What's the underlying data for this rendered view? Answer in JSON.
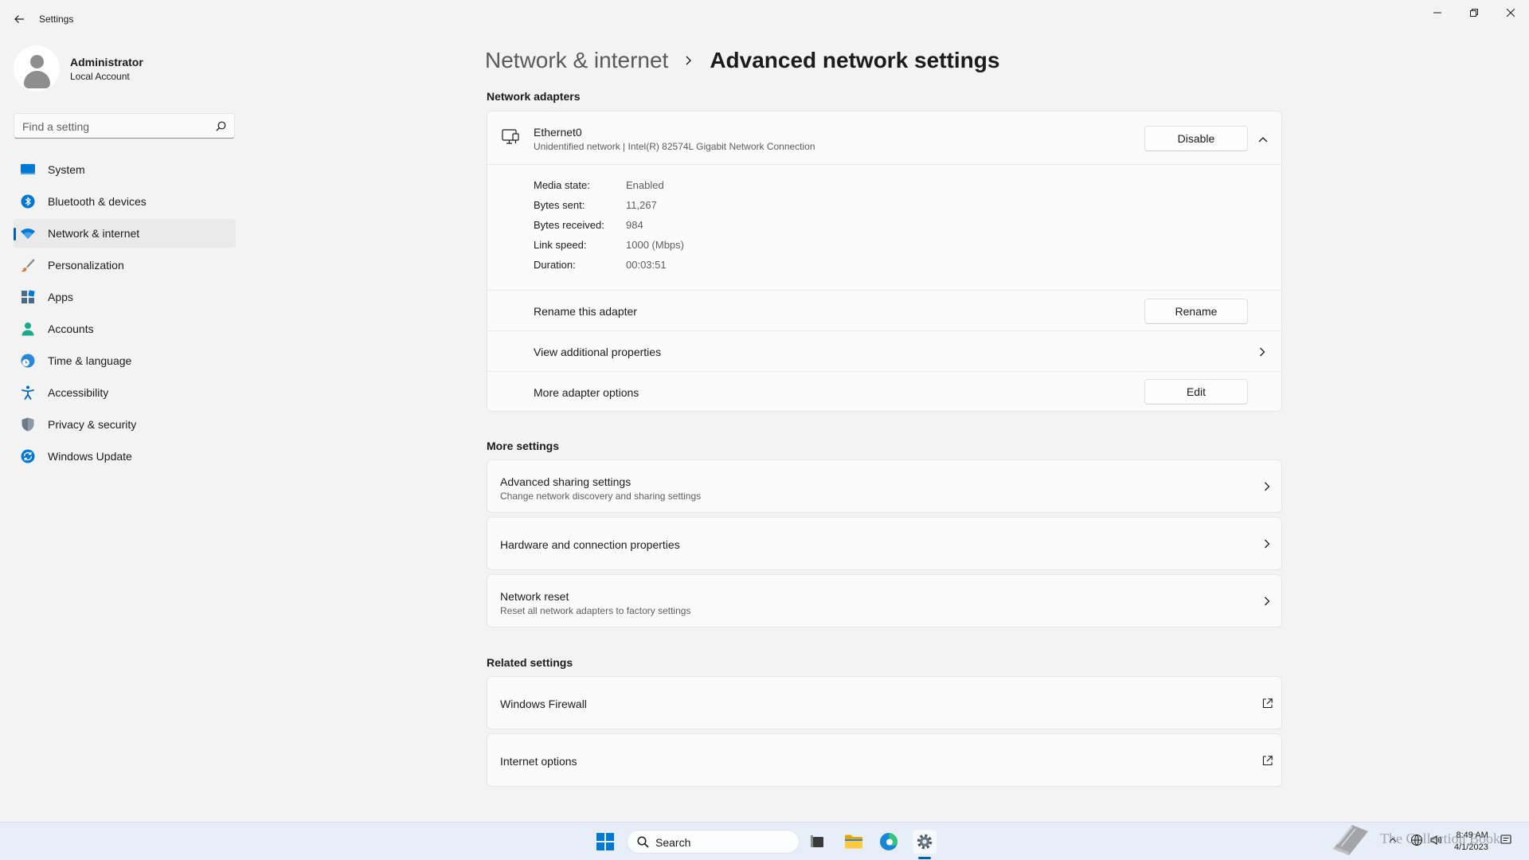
{
  "window": {
    "title": "Settings"
  },
  "profile": {
    "name": "Administrator",
    "account_type": "Local Account"
  },
  "search": {
    "placeholder": "Find a setting"
  },
  "sidebar": {
    "items": [
      {
        "label": "System",
        "icon": "system-icon",
        "color": "#0078d4",
        "active": false
      },
      {
        "label": "Bluetooth & devices",
        "icon": "bluetooth-icon",
        "color": "#0078d4",
        "active": false
      },
      {
        "label": "Network & internet",
        "icon": "wifi-icon",
        "color": "#0078d4",
        "active": true
      },
      {
        "label": "Personalization",
        "icon": "brush-icon",
        "color": "#d67d2f",
        "active": false
      },
      {
        "label": "Apps",
        "icon": "apps-icon",
        "color": "#4a6b8c",
        "active": false
      },
      {
        "label": "Accounts",
        "icon": "person-icon",
        "color": "#1aab8a",
        "active": false
      },
      {
        "label": "Time & language",
        "icon": "globe-clock-icon",
        "color": "#2b88d8",
        "active": false
      },
      {
        "label": "Accessibility",
        "icon": "accessibility-icon",
        "color": "#0067c0",
        "active": false
      },
      {
        "label": "Privacy & security",
        "icon": "shield-icon",
        "color": "#6d7a88",
        "active": false
      },
      {
        "label": "Windows Update",
        "icon": "update-icon",
        "color": "#0078d4",
        "active": false
      }
    ]
  },
  "breadcrumb": {
    "parent": "Network & internet",
    "current": "Advanced network settings"
  },
  "network_adapters": {
    "section_title": "Network adapters",
    "adapter": {
      "name": "Ethernet0",
      "description": "Unidentified network | Intel(R) 82574L Gigabit Network Connection",
      "disable_label": "Disable",
      "properties": [
        {
          "key": "Media state:",
          "value": "Enabled"
        },
        {
          "key": "Bytes sent:",
          "value": "11,267"
        },
        {
          "key": "Bytes received:",
          "value": "984"
        },
        {
          "key": "Link speed:",
          "value": "1000 (Mbps)"
        },
        {
          "key": "Duration:",
          "value": "00:03:51"
        }
      ],
      "rename": {
        "label": "Rename this adapter",
        "button": "Rename"
      },
      "view_props": {
        "label": "View additional properties"
      },
      "more_options": {
        "label": "More adapter options",
        "button": "Edit"
      }
    }
  },
  "more_settings": {
    "section_title": "More settings",
    "items": [
      {
        "title": "Advanced sharing settings",
        "description": "Change network discovery and sharing settings"
      },
      {
        "title": "Hardware and connection properties",
        "description": ""
      },
      {
        "title": "Network reset",
        "description": "Reset all network adapters to factory settings"
      }
    ]
  },
  "related_settings": {
    "section_title": "Related settings",
    "items": [
      {
        "title": "Windows Firewall"
      },
      {
        "title": "Internet options"
      }
    ]
  },
  "taskbar": {
    "search_label": "Search",
    "time": "8:49 AM",
    "date": "4/1/2023",
    "watermark": "The Collection Book"
  },
  "colors": {
    "accent": "#005fb8",
    "background": "#f3f3f3",
    "card": "#fbfbfb"
  }
}
